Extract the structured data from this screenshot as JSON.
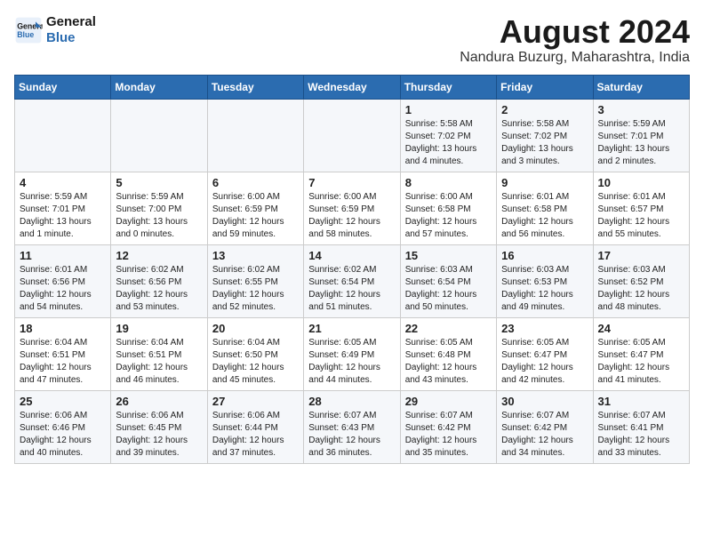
{
  "header": {
    "logo_line1": "General",
    "logo_line2": "Blue",
    "month_year": "August 2024",
    "location": "Nandura Buzurg, Maharashtra, India"
  },
  "weekdays": [
    "Sunday",
    "Monday",
    "Tuesday",
    "Wednesday",
    "Thursday",
    "Friday",
    "Saturday"
  ],
  "weeks": [
    [
      {
        "day": "",
        "info": ""
      },
      {
        "day": "",
        "info": ""
      },
      {
        "day": "",
        "info": ""
      },
      {
        "day": "",
        "info": ""
      },
      {
        "day": "1",
        "info": "Sunrise: 5:58 AM\nSunset: 7:02 PM\nDaylight: 13 hours\nand 4 minutes."
      },
      {
        "day": "2",
        "info": "Sunrise: 5:58 AM\nSunset: 7:02 PM\nDaylight: 13 hours\nand 3 minutes."
      },
      {
        "day": "3",
        "info": "Sunrise: 5:59 AM\nSunset: 7:01 PM\nDaylight: 13 hours\nand 2 minutes."
      }
    ],
    [
      {
        "day": "4",
        "info": "Sunrise: 5:59 AM\nSunset: 7:01 PM\nDaylight: 13 hours\nand 1 minute."
      },
      {
        "day": "5",
        "info": "Sunrise: 5:59 AM\nSunset: 7:00 PM\nDaylight: 13 hours\nand 0 minutes."
      },
      {
        "day": "6",
        "info": "Sunrise: 6:00 AM\nSunset: 6:59 PM\nDaylight: 12 hours\nand 59 minutes."
      },
      {
        "day": "7",
        "info": "Sunrise: 6:00 AM\nSunset: 6:59 PM\nDaylight: 12 hours\nand 58 minutes."
      },
      {
        "day": "8",
        "info": "Sunrise: 6:00 AM\nSunset: 6:58 PM\nDaylight: 12 hours\nand 57 minutes."
      },
      {
        "day": "9",
        "info": "Sunrise: 6:01 AM\nSunset: 6:58 PM\nDaylight: 12 hours\nand 56 minutes."
      },
      {
        "day": "10",
        "info": "Sunrise: 6:01 AM\nSunset: 6:57 PM\nDaylight: 12 hours\nand 55 minutes."
      }
    ],
    [
      {
        "day": "11",
        "info": "Sunrise: 6:01 AM\nSunset: 6:56 PM\nDaylight: 12 hours\nand 54 minutes."
      },
      {
        "day": "12",
        "info": "Sunrise: 6:02 AM\nSunset: 6:56 PM\nDaylight: 12 hours\nand 53 minutes."
      },
      {
        "day": "13",
        "info": "Sunrise: 6:02 AM\nSunset: 6:55 PM\nDaylight: 12 hours\nand 52 minutes."
      },
      {
        "day": "14",
        "info": "Sunrise: 6:02 AM\nSunset: 6:54 PM\nDaylight: 12 hours\nand 51 minutes."
      },
      {
        "day": "15",
        "info": "Sunrise: 6:03 AM\nSunset: 6:54 PM\nDaylight: 12 hours\nand 50 minutes."
      },
      {
        "day": "16",
        "info": "Sunrise: 6:03 AM\nSunset: 6:53 PM\nDaylight: 12 hours\nand 49 minutes."
      },
      {
        "day": "17",
        "info": "Sunrise: 6:03 AM\nSunset: 6:52 PM\nDaylight: 12 hours\nand 48 minutes."
      }
    ],
    [
      {
        "day": "18",
        "info": "Sunrise: 6:04 AM\nSunset: 6:51 PM\nDaylight: 12 hours\nand 47 minutes."
      },
      {
        "day": "19",
        "info": "Sunrise: 6:04 AM\nSunset: 6:51 PM\nDaylight: 12 hours\nand 46 minutes."
      },
      {
        "day": "20",
        "info": "Sunrise: 6:04 AM\nSunset: 6:50 PM\nDaylight: 12 hours\nand 45 minutes."
      },
      {
        "day": "21",
        "info": "Sunrise: 6:05 AM\nSunset: 6:49 PM\nDaylight: 12 hours\nand 44 minutes."
      },
      {
        "day": "22",
        "info": "Sunrise: 6:05 AM\nSunset: 6:48 PM\nDaylight: 12 hours\nand 43 minutes."
      },
      {
        "day": "23",
        "info": "Sunrise: 6:05 AM\nSunset: 6:47 PM\nDaylight: 12 hours\nand 42 minutes."
      },
      {
        "day": "24",
        "info": "Sunrise: 6:05 AM\nSunset: 6:47 PM\nDaylight: 12 hours\nand 41 minutes."
      }
    ],
    [
      {
        "day": "25",
        "info": "Sunrise: 6:06 AM\nSunset: 6:46 PM\nDaylight: 12 hours\nand 40 minutes."
      },
      {
        "day": "26",
        "info": "Sunrise: 6:06 AM\nSunset: 6:45 PM\nDaylight: 12 hours\nand 39 minutes."
      },
      {
        "day": "27",
        "info": "Sunrise: 6:06 AM\nSunset: 6:44 PM\nDaylight: 12 hours\nand 37 minutes."
      },
      {
        "day": "28",
        "info": "Sunrise: 6:07 AM\nSunset: 6:43 PM\nDaylight: 12 hours\nand 36 minutes."
      },
      {
        "day": "29",
        "info": "Sunrise: 6:07 AM\nSunset: 6:42 PM\nDaylight: 12 hours\nand 35 minutes."
      },
      {
        "day": "30",
        "info": "Sunrise: 6:07 AM\nSunset: 6:42 PM\nDaylight: 12 hours\nand 34 minutes."
      },
      {
        "day": "31",
        "info": "Sunrise: 6:07 AM\nSunset: 6:41 PM\nDaylight: 12 hours\nand 33 minutes."
      }
    ]
  ]
}
